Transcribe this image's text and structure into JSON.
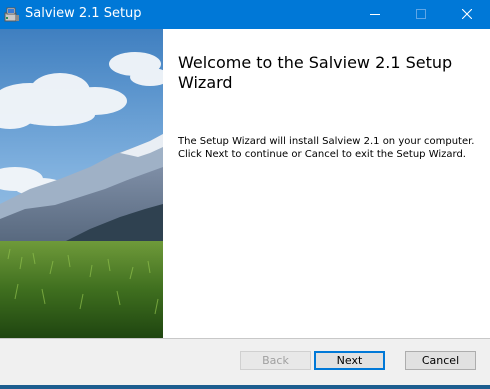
{
  "window": {
    "title": "Salview 2.1 Setup",
    "accent_color": "#0078d7"
  },
  "titlebar": {
    "icon": "installer-icon",
    "controls": [
      "minimize-icon",
      "maximize-icon",
      "close-icon"
    ]
  },
  "banner": {
    "image": "mountain-meadow-landscape"
  },
  "content": {
    "heading": "Welcome to the Salview 2.1 Setup Wizard",
    "description": "The Setup Wizard will install Salview 2.1 on your computer. Click Next to continue or Cancel to exit the Setup Wizard."
  },
  "footer": {
    "back_label": "Back",
    "next_label": "Next",
    "cancel_label": "Cancel"
  }
}
